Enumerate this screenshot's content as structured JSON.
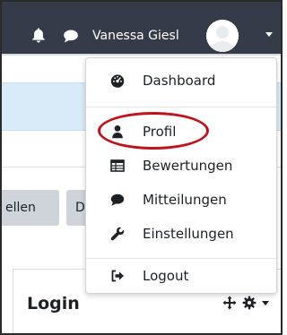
{
  "navbar": {
    "username": "Vanessa Giesl",
    "icons": {
      "notifications": "bell-icon",
      "messages": "chat-bubble-icon",
      "avatar": "user-avatar",
      "menu_toggle": "caret-down-icon"
    },
    "background_color": "#353b48"
  },
  "background_page": {
    "button_1_label": "ellen",
    "button_2_label": "D",
    "block_title": "Login",
    "block_icons": [
      "move-icon",
      "gear-icon",
      "caret-down-icon"
    ]
  },
  "user_menu": {
    "items": [
      {
        "label": "Dashboard",
        "icon": "dashboard-gauge-icon"
      },
      {
        "label": "Profil",
        "icon": "user-icon",
        "highlighted": true
      },
      {
        "label": "Bewertungen",
        "icon": "grades-table-icon"
      },
      {
        "label": "Mitteilungen",
        "icon": "message-bubble-icon"
      },
      {
        "label": "Einstellungen",
        "icon": "wrench-icon"
      },
      {
        "label": "Logout",
        "icon": "sign-out-icon"
      }
    ]
  },
  "colors": {
    "highlight_ring": "#c0121c",
    "alert_background": "#d9eaf8",
    "button_background": "#ced4da"
  }
}
